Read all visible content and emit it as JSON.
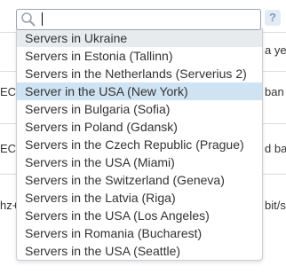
{
  "background": {
    "rows": [
      {
        "left": "",
        "right": "a ye"
      },
      {
        "left": "EC",
        "right": "ban"
      },
      {
        "left": "EC",
        "right": "d ba"
      },
      {
        "left": "hz+",
        "right": "bit/s"
      }
    ]
  },
  "search": {
    "value": "",
    "placeholder": ""
  },
  "help": {
    "label": "?"
  },
  "dropdown": {
    "items": [
      "Servers in Ukraine",
      "Servers in Estonia (Tallinn)",
      "Servers in the Netherlands (Serverius 2)",
      "Server in the USA (New York)",
      "Servers in Bulgaria (Sofia)",
      "Servers in Poland (Gdansk)",
      "Servers in the Czech Republic (Prague)",
      "Servers in the USA (Miami)",
      "Servers in the Switzerland (Geneva)",
      "Servers in the Latvia (Riga)",
      "Servers in the USA (Los Angeles)",
      "Servers in Romania (Bucharest)",
      "Servers in the USA (Seattle)"
    ],
    "selected_index": 3
  },
  "colors": {
    "highlight": "#cfe3f3",
    "first_item": "#e8ebee",
    "help_bg": "#e3ecf5"
  }
}
